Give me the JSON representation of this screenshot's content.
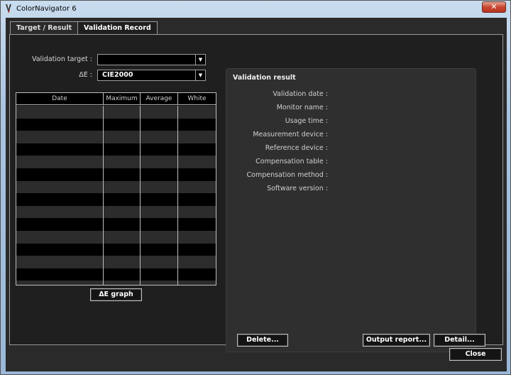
{
  "window": {
    "title": "ColorNavigator 6",
    "close_glyph": "✕"
  },
  "tabs": [
    {
      "label": "Target / Result"
    },
    {
      "label": "Validation Record"
    }
  ],
  "form": {
    "validation_target_label": "Validation target :",
    "validation_target_value": "",
    "delta_e_label": "ΔE :",
    "delta_e_value": "CIE2000"
  },
  "table": {
    "columns": [
      "Date",
      "Maximum",
      "Average",
      "White"
    ],
    "rows": []
  },
  "buttons": {
    "delta_e_graph": "ΔE graph",
    "delete": "Delete...",
    "output_report": "Output report...",
    "detail": "Detail...",
    "close": "Close"
  },
  "result": {
    "title": "Validation result",
    "fields": [
      "Validation date :",
      "Monitor name :",
      "Usage time :",
      "Measurement device :",
      "Reference device :",
      "Compensation table :",
      "Compensation method :",
      "Software version :"
    ]
  },
  "icons": {
    "dropdown": "chevron-down-icon",
    "app": "colornavigator-icon"
  },
  "colors": {
    "panel_bg": "#1f1f1f",
    "row_light": "#2c2c2c",
    "row_dark": "#000000",
    "border": "#bdbdbd"
  }
}
